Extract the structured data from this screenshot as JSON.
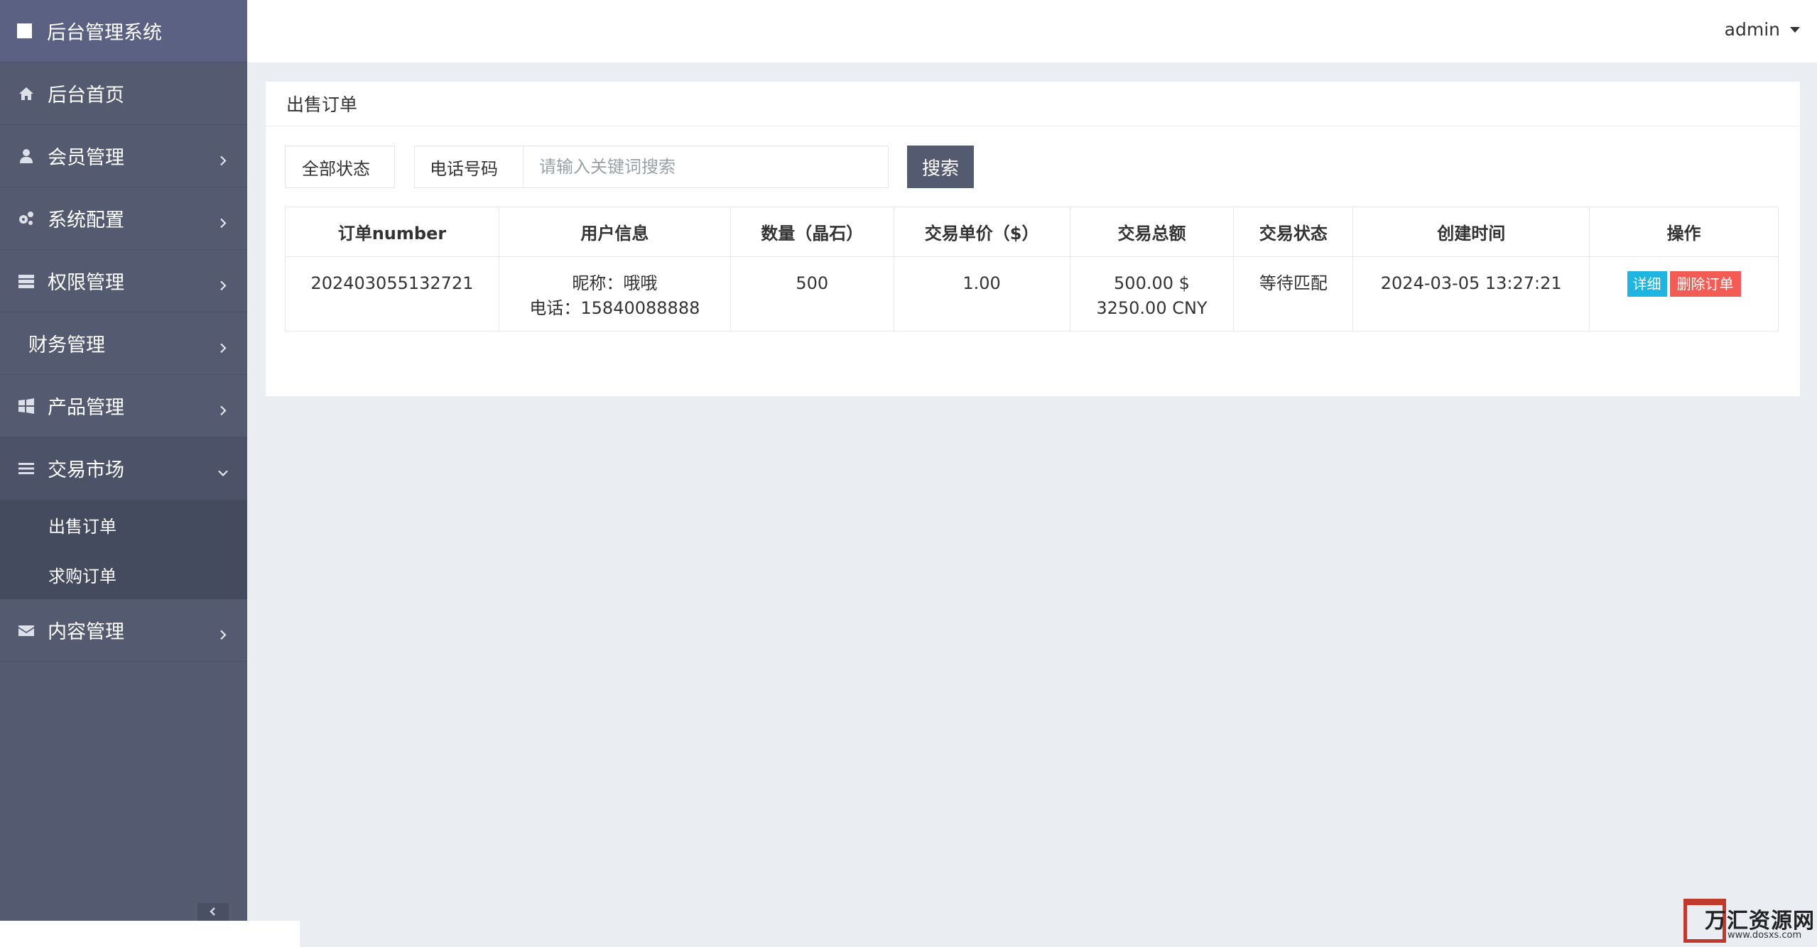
{
  "app": {
    "title": "后台管理系统"
  },
  "header": {
    "user": "admin"
  },
  "sidebar": {
    "items": [
      {
        "label": "后台首页",
        "icon": "home-icon"
      },
      {
        "label": "会员管理",
        "icon": "user-icon"
      },
      {
        "label": "系统配置",
        "icon": "gears-icon"
      },
      {
        "label": "权限管理",
        "icon": "server-icon"
      },
      {
        "label": "财务管理",
        "icon": ""
      },
      {
        "label": "产品管理",
        "icon": "windows-icon"
      },
      {
        "label": "交易市场",
        "icon": "bars-icon"
      },
      {
        "label": "内容管理",
        "icon": "envelope-icon"
      }
    ],
    "submenu": [
      {
        "label": "出售订单"
      },
      {
        "label": "求购订单"
      }
    ]
  },
  "page": {
    "title": "出售订单",
    "filters": {
      "status": "全部状态",
      "phone_label": "电话号码",
      "search_placeholder": "请输入关键词搜索",
      "search_button": "搜索"
    },
    "table": {
      "headers": [
        "订单number",
        "用户信息",
        "数量（晶石）",
        "交易单价（$）",
        "交易总额",
        "交易状态",
        "创建时间",
        "操作"
      ],
      "rows": [
        {
          "order_no": "202403055132721",
          "nickname": "昵称：哦哦",
          "phone": "电话：15840088888",
          "quantity": "500",
          "unit_price": "1.00",
          "total_usd": "500.00 $",
          "total_cny": "3250.00 CNY",
          "status": "等待匹配",
          "created": "2024-03-05 13:27:21",
          "detail_btn": "详细",
          "delete_btn": "删除订单"
        }
      ]
    }
  },
  "watermark": {
    "text": "万汇资源网",
    "url": "www.dosxs.com"
  },
  "colors": {
    "sidebar_bg": "#545b70",
    "brand_bg": "#5a6183",
    "detail_btn": "#1fb5e0",
    "delete_btn": "#f25c54",
    "content_bg": "#eaedf1"
  }
}
